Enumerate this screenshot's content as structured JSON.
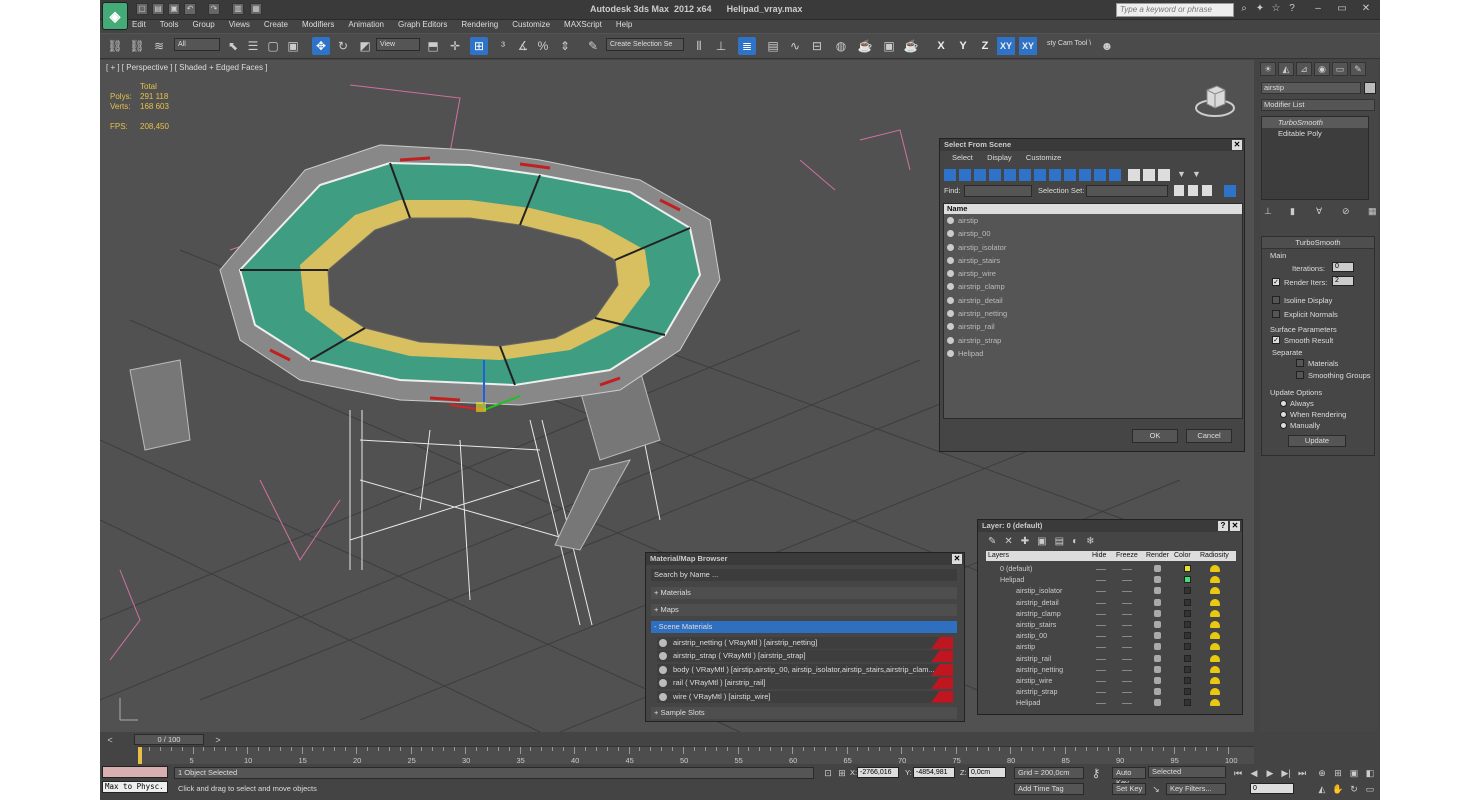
{
  "window": {
    "title": "Autodesk 3ds Max  2012 x64      Helipad_vray.max",
    "help_placeholder": "Type a keyword or phrase"
  },
  "menu": [
    "Edit",
    "Tools",
    "Group",
    "Views",
    "Create",
    "Modifiers",
    "Animation",
    "Graph Editors",
    "Rendering",
    "Customize",
    "MAXScript",
    "Help"
  ],
  "toolbar": {
    "selection_filter": "All",
    "ref_coord": "View",
    "named_selection": "Create Selection Se",
    "extra_tool": "sty Cam Tool \\",
    "axes": [
      "X",
      "Y",
      "Z",
      "XY"
    ]
  },
  "viewport": {
    "label": "[ + ] [ Perspective ] [ Shaded + Edged Faces ]",
    "stats_header": "Total",
    "polys_label": "Polys:",
    "polys": "291 118",
    "verts_label": "Verts:",
    "verts": "168 603",
    "fps_label": "FPS:",
    "fps": "208,450"
  },
  "command_panel": {
    "object_name": "airstip",
    "modifier_list": "Modifier List",
    "stack": [
      "TurboSmooth",
      "Editable Poly"
    ],
    "turbosmooth": {
      "title": "TurboSmooth",
      "main": "Main",
      "iterations_label": "Iterations:",
      "iterations": "0",
      "render_iters_label": "Render Iters:",
      "render_iters": "2",
      "isoline": "Isoline Display",
      "explicit": "Explicit Normals",
      "surface": "Surface Parameters",
      "smooth_result": "Smooth Result",
      "separate": "Separate",
      "materials": "Materials",
      "smoothing_groups": "Smoothing Groups",
      "update_options": "Update Options",
      "always": "Always",
      "when_rendering": "When Rendering",
      "manually": "Manually",
      "update_btn": "Update"
    }
  },
  "select_from_scene": {
    "title": "Select From Scene",
    "menu": [
      "Select",
      "Display",
      "Customize"
    ],
    "find_label": "Find:",
    "selection_set_label": "Selection Set:",
    "column": "Name",
    "items": [
      "airstip",
      "airstip_00",
      "airstip_isolator",
      "airstip_stairs",
      "airstip_wire",
      "airstrip_clamp",
      "airstrip_detail",
      "airstrip_netting",
      "airstrip_rail",
      "airstrip_strap",
      "Helipad"
    ],
    "ok": "OK",
    "cancel": "Cancel"
  },
  "material_browser": {
    "title": "Material/Map Browser",
    "search": "Search by Name ...",
    "groups": [
      "+ Materials",
      "+ Maps",
      "- Scene Materials",
      "+ Sample Slots"
    ],
    "materials": [
      "airstrip_netting  ( VRayMtl )  [airstrip_netting]",
      "airstrip_strap  ( VRayMtl )  [airstrip_strap]",
      "body  ( VRayMtl )  [airstip,airstip_00, airstip_isolator,airstip_stairs,airstrip_clam...",
      "rail  ( VRayMtl )  [airstrip_rail]",
      "wire  ( VRayMtl )  [airstip_wire]"
    ]
  },
  "layer_manager": {
    "title": "Layer: 0 (default)",
    "columns": [
      "Layers",
      "Hide",
      "Freeze",
      "Render",
      "Color",
      "Radiosity"
    ],
    "rows": [
      {
        "name": "0 (default)",
        "indent": 0,
        "color": "#e8e030"
      },
      {
        "name": "Helipad",
        "indent": 0,
        "color": "#40e070"
      },
      {
        "name": "airstip_isolator",
        "indent": 1,
        "color": "#333333"
      },
      {
        "name": "airstrip_detail",
        "indent": 1,
        "color": "#333333"
      },
      {
        "name": "airstrip_clamp",
        "indent": 1,
        "color": "#333333"
      },
      {
        "name": "airstip_stairs",
        "indent": 1,
        "color": "#333333"
      },
      {
        "name": "airstip_00",
        "indent": 1,
        "color": "#333333"
      },
      {
        "name": "airstip",
        "indent": 1,
        "color": "#333333"
      },
      {
        "name": "airstrip_rail",
        "indent": 1,
        "color": "#333333"
      },
      {
        "name": "airstrip_netting",
        "indent": 1,
        "color": "#333333"
      },
      {
        "name": "airstip_wire",
        "indent": 1,
        "color": "#333333"
      },
      {
        "name": "airstrip_strap",
        "indent": 1,
        "color": "#333333"
      },
      {
        "name": "Helipad",
        "indent": 1,
        "color": "#333333"
      }
    ]
  },
  "timeline": {
    "slider": "0 / 100",
    "ticks": [
      "0",
      "5",
      "10",
      "15",
      "20",
      "25",
      "30",
      "35",
      "40",
      "45",
      "50",
      "55",
      "60",
      "65",
      "70",
      "75",
      "80",
      "85",
      "90",
      "95",
      "100"
    ]
  },
  "status": {
    "maxscript": "Max to Physc.",
    "selected": "1 Object Selected",
    "prompt": "Click and drag to select and move objects",
    "x_label": "X:",
    "x": "-2766,016",
    "y_label": "Y:",
    "y": "-4854,981",
    "z_label": "Z:",
    "z": "0,0cm",
    "grid": "Grid = 200,0cm",
    "add_time_tag": "Add Time Tag",
    "auto_key": "Auto Key",
    "set_key": "Set Key",
    "key_mode": "Selected",
    "key_filters": "Key Filters...",
    "frame": "0"
  }
}
